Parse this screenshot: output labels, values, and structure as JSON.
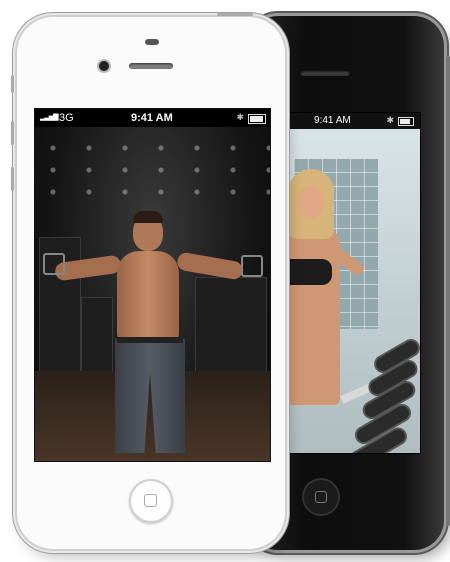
{
  "front_phone": {
    "status_bar": {
      "carrier": "3G",
      "time": "9:41 AM",
      "signal": "▂▃▅▇",
      "bluetooth": "✱"
    },
    "icons": {
      "camera": "camera-icon",
      "home": "home-button-icon",
      "battery": "battery-icon"
    }
  },
  "back_phone": {
    "status_bar": {
      "time": "9:41 AM",
      "bluetooth": "✱"
    },
    "icons": {
      "home": "home-button-icon",
      "battery": "battery-icon"
    }
  }
}
